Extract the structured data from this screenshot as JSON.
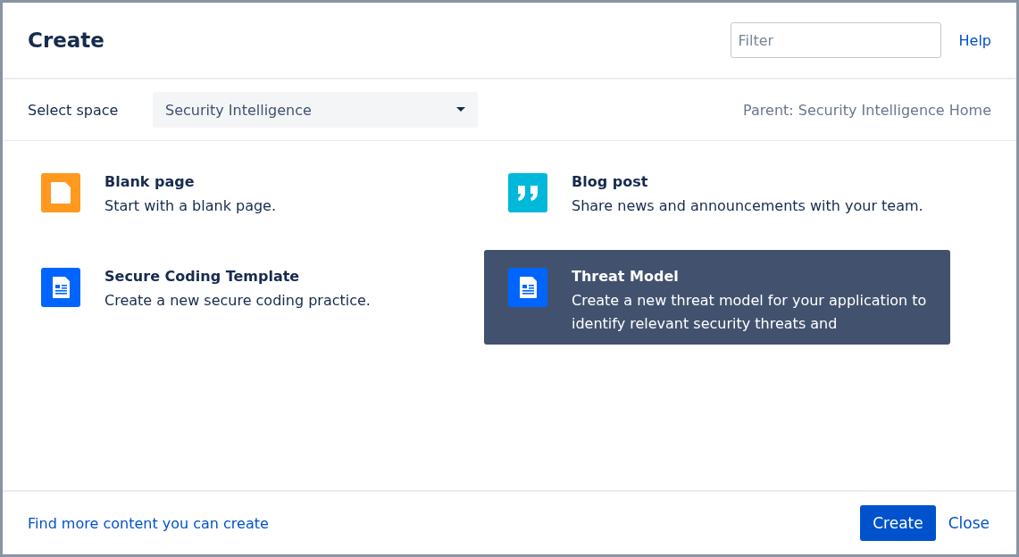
{
  "dialog": {
    "title": "Create",
    "filter": {
      "placeholder": "Filter"
    },
    "help_link": "Help"
  },
  "space": {
    "label": "Select space",
    "value": "Security Intelligence",
    "parent": "Parent: Security Intelligence Home"
  },
  "templates": [
    {
      "kind": "blank",
      "title": "Blank page",
      "description": "Start with a blank page.",
      "selected": false
    },
    {
      "kind": "blog",
      "title": "Blog post",
      "description": "Share news and announcements with your team.",
      "selected": false
    },
    {
      "kind": "template",
      "title": "Secure Coding Template",
      "description": "Create a new secure coding practice.",
      "selected": false
    },
    {
      "kind": "template",
      "title": "Threat Model",
      "description": "Create a new threat model for your application to identify relevant security threats and",
      "selected": true
    }
  ],
  "footer": {
    "link": "Find more content you can create",
    "buttons": [
      {
        "label": "Create",
        "kind": "primary"
      },
      {
        "label": "Close",
        "kind": "link"
      }
    ]
  }
}
